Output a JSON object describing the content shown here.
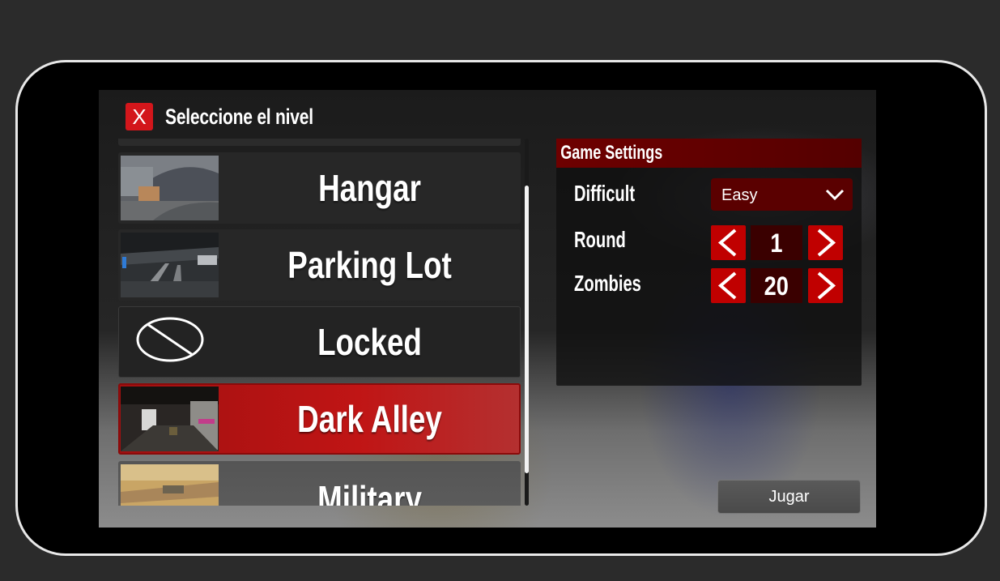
{
  "header": {
    "close_label": "X",
    "title": "Seleccione el nivel"
  },
  "levels": [
    {
      "name": "Hangar",
      "state": "normal",
      "thumbnail": "hangar-thumbnail"
    },
    {
      "name": "Parking Lot",
      "state": "normal",
      "thumbnail": "parking-lot-thumbnail"
    },
    {
      "name": "Locked",
      "state": "locked",
      "thumbnail": "locked-icon"
    },
    {
      "name": "Dark Alley",
      "state": "selected",
      "thumbnail": "dark-alley-thumbnail"
    },
    {
      "name": "Military",
      "state": "normal",
      "thumbnail": "military-thumbnail"
    }
  ],
  "settings": {
    "header": "Game Settings",
    "difficulty": {
      "label": "Difficult",
      "value": "Easy"
    },
    "round": {
      "label": "Round",
      "value": "1"
    },
    "zombies": {
      "label": "Zombies",
      "value": "20"
    }
  },
  "play_button_label": "Jugar",
  "colors": {
    "accent_red": "#c00000",
    "selected_card": "#b01313",
    "header_dark_red": "#6e0000"
  }
}
